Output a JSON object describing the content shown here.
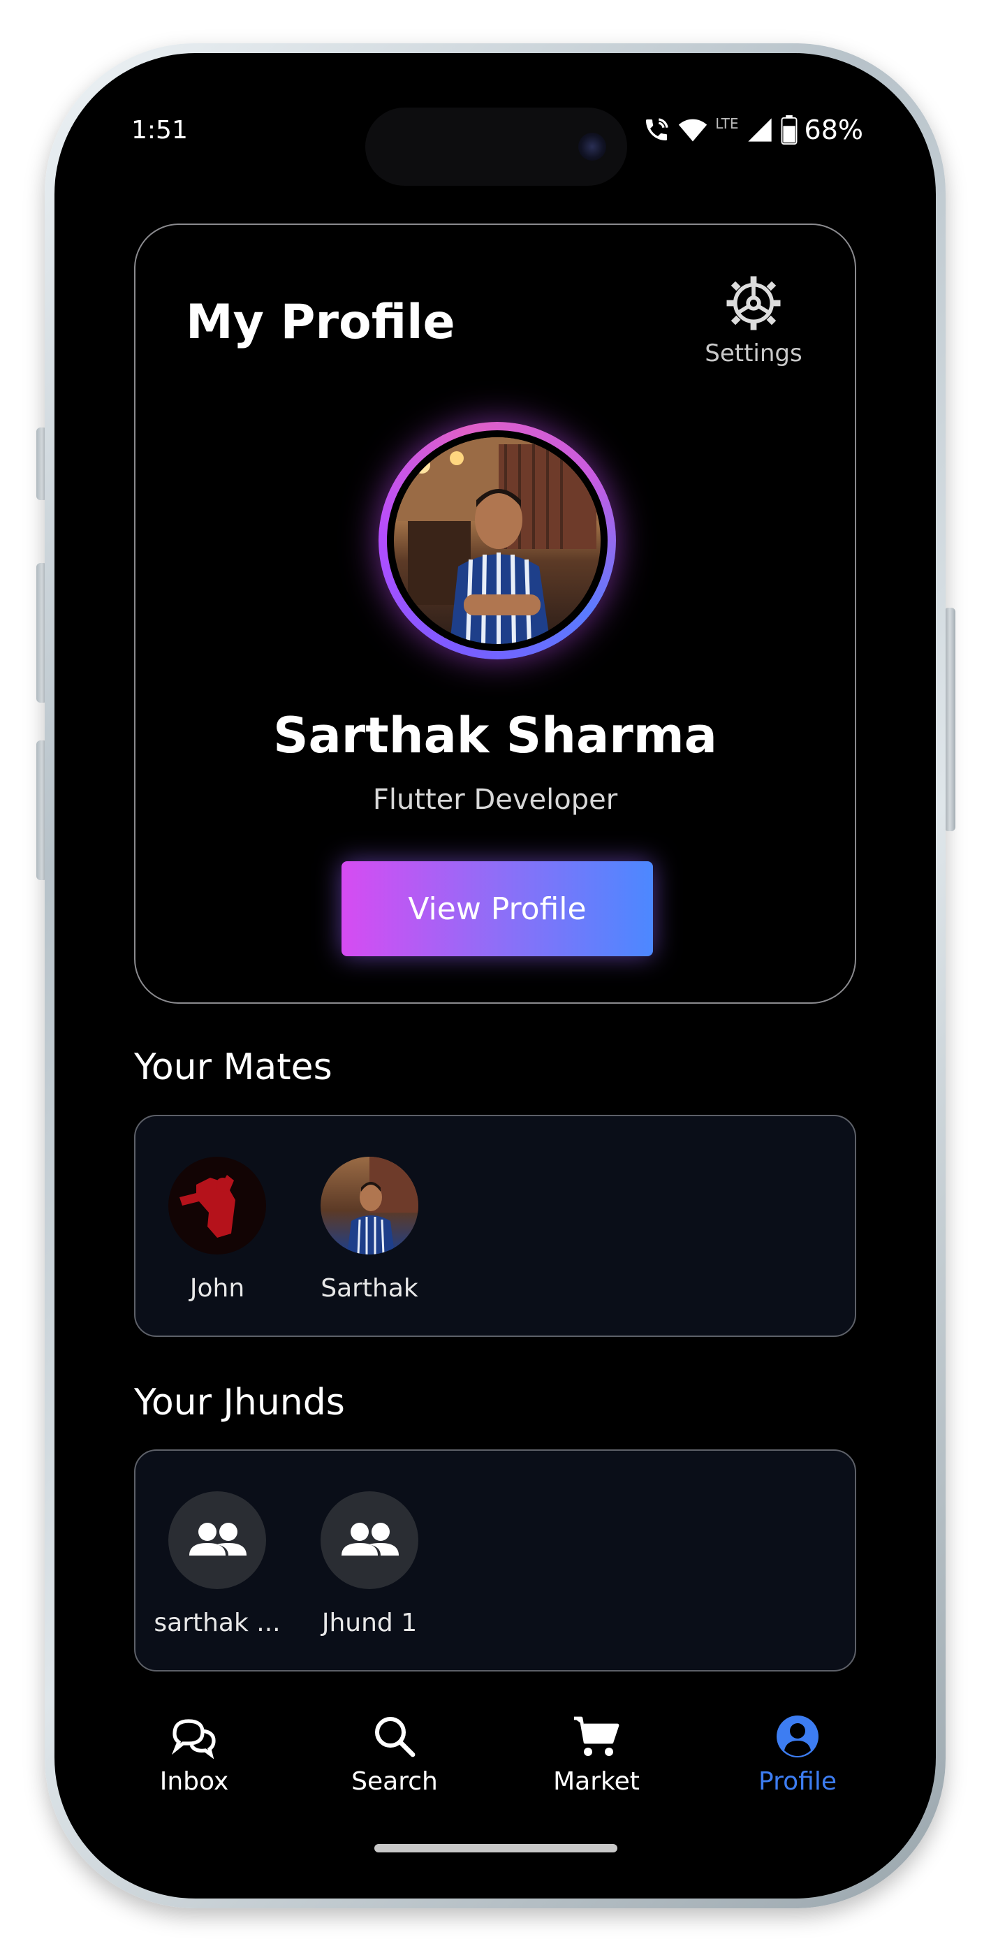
{
  "status_bar": {
    "time": "1:51",
    "network": "LTE",
    "battery": "68%"
  },
  "header": {
    "title": "My Profile",
    "settings_label": "Settings"
  },
  "profile": {
    "name": "Sarthak Sharma",
    "role": "Flutter Developer",
    "view_button": "View Profile"
  },
  "mates": {
    "title": "Your Mates",
    "items": [
      {
        "label": "John"
      },
      {
        "label": "Sarthak"
      }
    ]
  },
  "jhunds": {
    "title": "Your Jhunds",
    "items": [
      {
        "label": "sarthak ..."
      },
      {
        "label": "Jhund 1"
      }
    ]
  },
  "nav": {
    "items": [
      {
        "label": "Inbox",
        "icon": "chat-bubbles-icon"
      },
      {
        "label": "Search",
        "icon": "search-icon"
      },
      {
        "label": "Market",
        "icon": "cart-icon"
      },
      {
        "label": "Profile",
        "icon": "profile-icon"
      }
    ],
    "active_color": "#3d7df2"
  }
}
